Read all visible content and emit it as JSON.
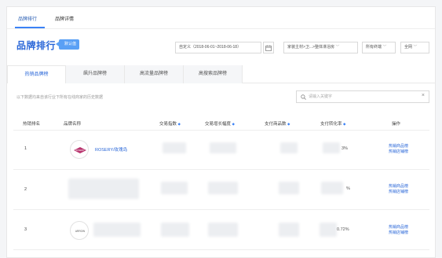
{
  "top_tabs": [
    "品牌排行",
    "品牌详情"
  ],
  "title": "品牌排行",
  "title_badge": "默认值",
  "filters": {
    "date": "自定义（2018-06-01~2018-06-18）",
    "category": "家装主材>卫...>整体淋浴房",
    "terminal": "所有终端",
    "network": "全网"
  },
  "sub_tabs": [
    "热销品牌榜",
    "飙升品牌榜",
    "高流量品牌榜",
    "高搜索品牌榜"
  ],
  "info_text": "以下数据均来自该行业下所有在线商家的历史数据",
  "search": {
    "placeholder": "请输入关键字"
  },
  "columns": [
    "热销排名",
    "品牌名称",
    "交易指数",
    "交易增长幅度",
    "支付商品数",
    "支付转化率",
    "操作"
  ],
  "rows": [
    {
      "rank": "1",
      "brand": "ROSERY/玫瑰岛",
      "logo_text": "ROSERY",
      "conversion": "3%",
      "ops": [
        "热销商品榜",
        "热销店铺榜"
      ]
    },
    {
      "rank": "2",
      "brand": "",
      "logo_text": "",
      "conversion": "%",
      "ops": [
        "热销商品榜",
        "热销店铺榜"
      ]
    },
    {
      "rank": "3",
      "brand": "",
      "logo_text": "ARROW",
      "conversion": "0.72%",
      "ops": [
        "热销商品榜",
        "热销店铺榜"
      ]
    }
  ],
  "colors": {
    "accent": "#2a67d8",
    "badge": "#5aa0f5"
  }
}
